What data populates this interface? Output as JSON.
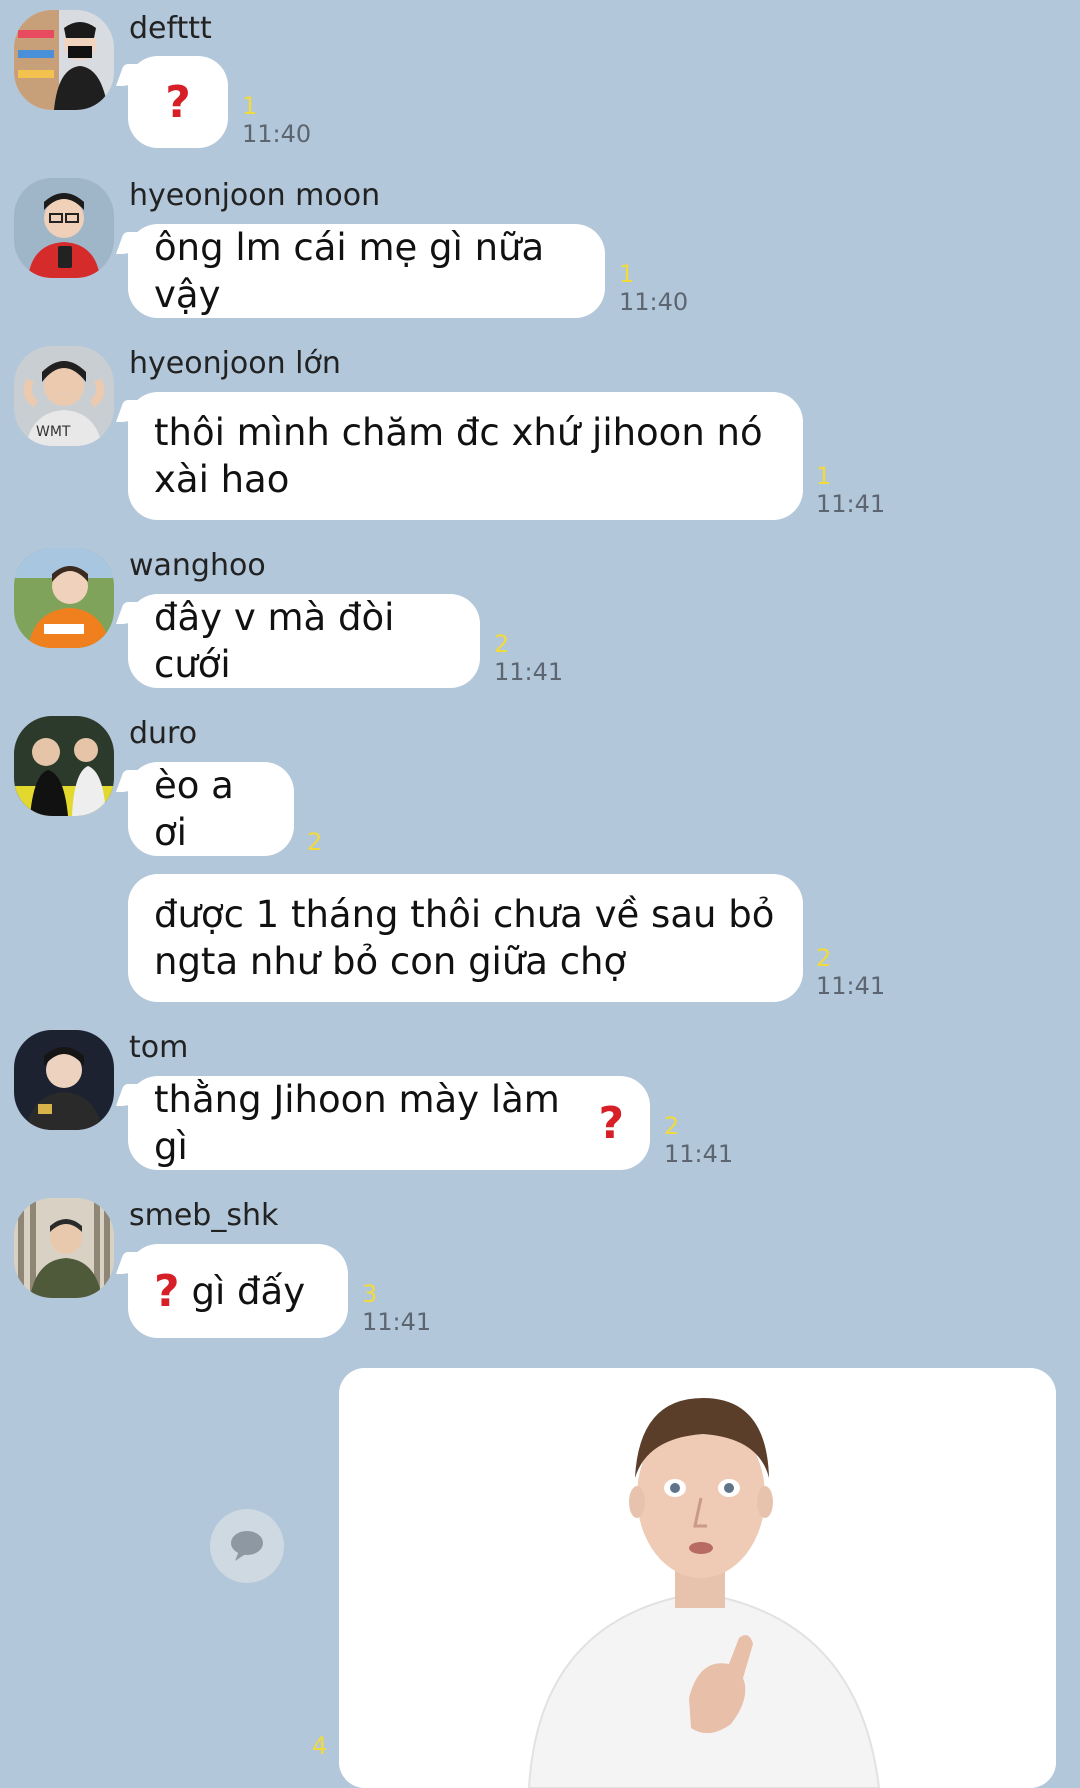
{
  "colors": {
    "background": "#b2c7da",
    "bubble": "#ffffff",
    "unread_count": "#f2da3a",
    "timestamp": "#5d6670",
    "question_mark": "#d61f26"
  },
  "messages": [
    {
      "sender": "defttt",
      "text": "",
      "has_question_icon": true,
      "unread": "1",
      "time": "11:40"
    },
    {
      "sender": "hyeonjoon moon",
      "text": "ông lm cái mẹ gì nữa vậy",
      "unread": "1",
      "time": "11:40"
    },
    {
      "sender": "hyeonjoon lớn",
      "text": "thôi mình chăm đc xhứ jihoon nó xài hao",
      "unread": "1",
      "time": "11:41"
    },
    {
      "sender": "wanghoo",
      "text": "đây v mà đòi cưới",
      "unread": "2",
      "time": "11:41"
    },
    {
      "sender": "duro",
      "text": "èo a ơi",
      "unread": "2",
      "time": ""
    },
    {
      "sender": "",
      "text": "được 1 tháng thôi chưa về sau bỏ ngta như bỏ con giữa chợ",
      "unread": "2",
      "time": "11:41"
    },
    {
      "sender": "tom",
      "text": "thằng Jihoon mày làm gì",
      "unread": "2",
      "time": "11:41"
    },
    {
      "sender": "smeb_shk",
      "text": "gì đấy",
      "unread": "3",
      "time": "11:41"
    }
  ],
  "image_message": {
    "unread": "4",
    "icons": {
      "share": "speech-bubble-icon"
    }
  },
  "icons": {
    "question": "red-question-mark-icon"
  }
}
